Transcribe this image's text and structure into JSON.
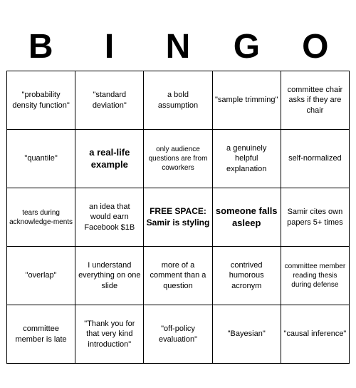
{
  "title": {
    "letters": [
      "B",
      "I",
      "N",
      "G",
      "O"
    ]
  },
  "cells": [
    {
      "text": "\"probability density function\"",
      "style": "normal"
    },
    {
      "text": "\"standard deviation\"",
      "style": "normal"
    },
    {
      "text": "a bold assumption",
      "style": "normal"
    },
    {
      "text": "\"sample trimming\"",
      "style": "normal"
    },
    {
      "text": "committee chair asks if they are chair",
      "style": "normal"
    },
    {
      "text": "\"quantile\"",
      "style": "normal"
    },
    {
      "text": "a real-life example",
      "style": "large-text"
    },
    {
      "text": "only audience questions are from coworkers",
      "style": "small"
    },
    {
      "text": "a genuinely helpful explanation",
      "style": "normal"
    },
    {
      "text": "self-normalized",
      "style": "normal"
    },
    {
      "text": "tears during acknowledge-ments",
      "style": "small"
    },
    {
      "text": "an idea that would earn Facebook $1B",
      "style": "normal"
    },
    {
      "text": "FREE SPACE: Samir is styling",
      "style": "free"
    },
    {
      "text": "someone falls asleep",
      "style": "large-text"
    },
    {
      "text": "Samir cites own papers 5+ times",
      "style": "normal"
    },
    {
      "text": "\"overlap\"",
      "style": "normal"
    },
    {
      "text": "I understand everything on one slide",
      "style": "normal"
    },
    {
      "text": "more of a comment than a question",
      "style": "normal"
    },
    {
      "text": "contrived humorous acronym",
      "style": "normal"
    },
    {
      "text": "committee member reading thesis during defense",
      "style": "small"
    },
    {
      "text": "committee member is late",
      "style": "normal"
    },
    {
      "text": "\"Thank you for that very kind introduction\"",
      "style": "normal"
    },
    {
      "text": "\"off-policy evaluation\"",
      "style": "normal"
    },
    {
      "text": "\"Bayesian\"",
      "style": "normal"
    },
    {
      "text": "\"causal inference\"",
      "style": "normal"
    }
  ]
}
